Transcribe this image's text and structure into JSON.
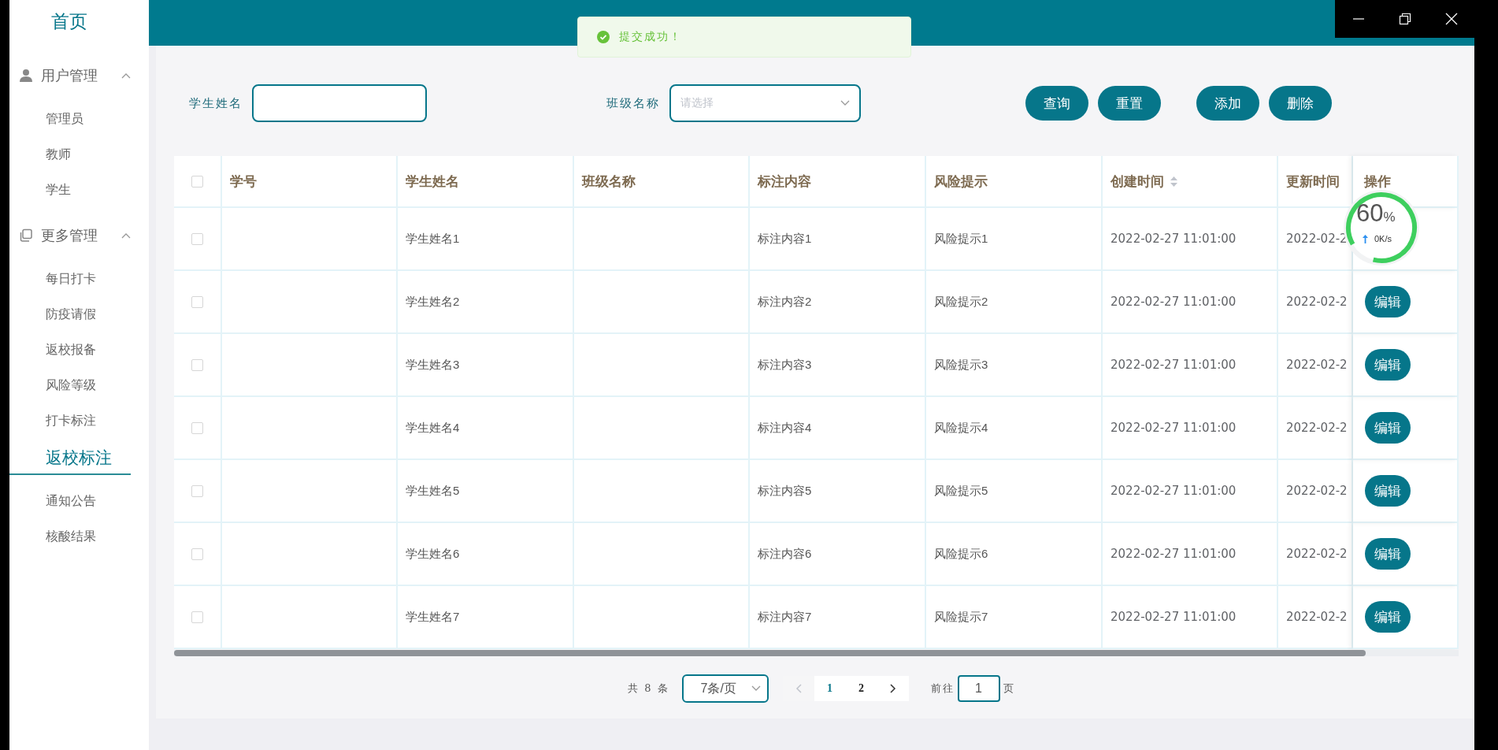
{
  "sidebar": {
    "home": "首页",
    "groups": [
      {
        "label": "用户管理",
        "expanded": true,
        "items": [
          {
            "label": "管理员",
            "selected": false
          },
          {
            "label": "教师",
            "selected": false
          },
          {
            "label": "学生",
            "selected": false
          }
        ]
      },
      {
        "label": "更多管理",
        "expanded": true,
        "items": [
          {
            "label": "每日打卡",
            "selected": false
          },
          {
            "label": "防疫请假",
            "selected": false
          },
          {
            "label": "返校报备",
            "selected": false
          },
          {
            "label": "风险等级",
            "selected": false
          },
          {
            "label": "打卡标注",
            "selected": false
          },
          {
            "label": "返校标注",
            "selected": true
          },
          {
            "label": "通知公告",
            "selected": false
          },
          {
            "label": "核酸结果",
            "selected": false
          }
        ]
      }
    ]
  },
  "toast": {
    "kind": "success",
    "text": "提交成功！"
  },
  "search": {
    "fields": [
      {
        "label": "学生姓名",
        "kind": "input"
      },
      {
        "label": "班级名称",
        "kind": "select",
        "placeholder": "请选择"
      }
    ],
    "buttons": [
      "查询",
      "重置",
      "添加",
      "删除"
    ]
  },
  "table": {
    "header_checked": false,
    "columns": [
      {
        "label": "学号",
        "sortable": false
      },
      {
        "label": "学生姓名",
        "sortable": false
      },
      {
        "label": "班级名称",
        "sortable": false
      },
      {
        "label": "标注内容",
        "sortable": false
      },
      {
        "label": "风险提示",
        "sortable": false
      },
      {
        "label": "创建时间",
        "sortable": true
      },
      {
        "label": "更新时间",
        "sortable": false
      },
      {
        "label": "操作",
        "sortable": false
      }
    ],
    "rows": [
      {
        "checked": false,
        "student_name": "学生姓名1",
        "note": "标注内容1",
        "risk": "风险提示1",
        "created": "2022-02-27 11:01:00",
        "updated": "2022-02-2"
      },
      {
        "checked": false,
        "student_name": "学生姓名2",
        "note": "标注内容2",
        "risk": "风险提示2",
        "created": "2022-02-27 11:01:00",
        "updated": "2022-02-2",
        "action": "编辑"
      },
      {
        "checked": false,
        "student_name": "学生姓名3",
        "note": "标注内容3",
        "risk": "风险提示3",
        "created": "2022-02-27 11:01:00",
        "updated": "2022-02-2",
        "action": "编辑"
      },
      {
        "checked": false,
        "student_name": "学生姓名4",
        "note": "标注内容4",
        "risk": "风险提示4",
        "created": "2022-02-27 11:01:00",
        "updated": "2022-02-2",
        "action": "编辑"
      },
      {
        "checked": false,
        "student_name": "学生姓名5",
        "note": "标注内容5",
        "risk": "风险提示5",
        "created": "2022-02-27 11:01:00",
        "updated": "2022-02-2",
        "action": "编辑"
      },
      {
        "checked": false,
        "student_name": "学生姓名6",
        "note": "标注内容6",
        "risk": "风险提示6",
        "created": "2022-02-27 11:01:00",
        "updated": "2022-02-2",
        "action": "编辑"
      },
      {
        "checked": false,
        "student_name": "学生姓名7",
        "note": "标注内容7",
        "risk": "风险提示7",
        "created": "2022-02-27 11:01:00",
        "updated": "2022-02-2",
        "action": "编辑"
      }
    ]
  },
  "pagination": {
    "total": "共 8 条",
    "page_size": "7条/页",
    "prev_disabled": true,
    "next_disabled": false,
    "pages": [
      {
        "label": "1",
        "selected": true
      },
      {
        "label": "2",
        "selected": false
      }
    ],
    "goto_label": "前往",
    "goto_value": "1",
    "goto_suffix": "页"
  },
  "monitor": {
    "percent": "60",
    "unit": "%",
    "speed": "0K/s"
  }
}
